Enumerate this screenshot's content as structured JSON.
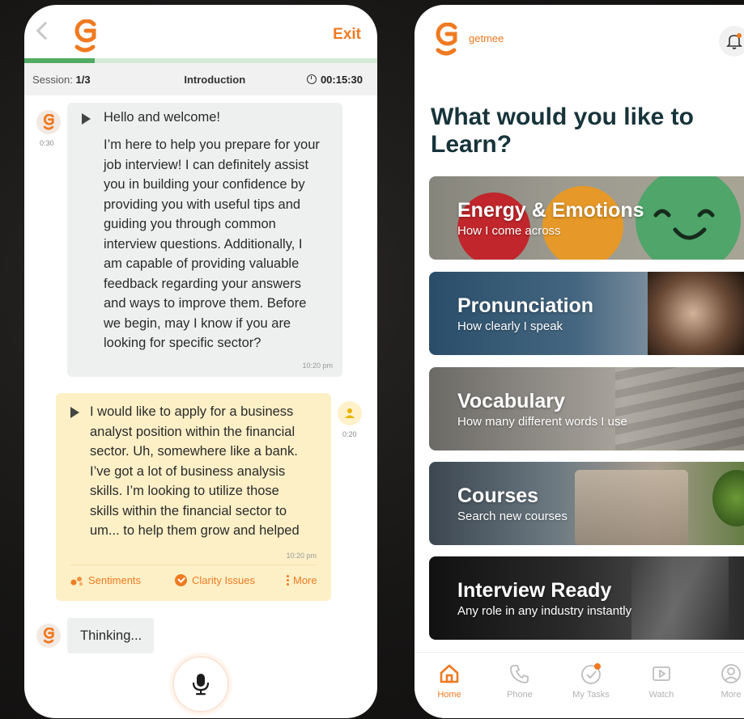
{
  "colors": {
    "brand_orange": "#ef7a21",
    "progress_green": "#52ab63",
    "heading_dark": "#17343a",
    "user_bubble": "#fdf0c7",
    "bot_bubble": "#eef0ef"
  },
  "interview": {
    "exit_label": "Exit",
    "progress_fraction": 0.2,
    "session_prefix": "Session:",
    "session_value": "1/3",
    "section_title": "Introduction",
    "timer": "00:15:30",
    "bot_message": {
      "avatar_time": "0:30",
      "greeting": "Hello and welcome!",
      "body_lines": [
        "I’m here to help you prepare for your",
        "job interview! I can definitely assist",
        "you in building your confidence by",
        "providing you with useful tips and",
        "guiding you through common",
        "interview questions. Additionally, I",
        "am capable of providing valuable",
        "feedback regarding your answers",
        "and ways to improve them. Before",
        "we begin, may I know if you are",
        "looking for specific sector?"
      ],
      "time": "10:20 pm"
    },
    "user_message": {
      "avatar_time": "0:20",
      "lines": [
        "I would like to apply for a business",
        "analyst position within the financial",
        "sector. Uh, somewhere like a bank.",
        "I’ve got a lot of business analysis",
        "skills. I’m looking to utilize those",
        "skills within the financial sector to",
        "um... to help them grow and helped"
      ],
      "time": "10:20 pm",
      "actions": {
        "sentiments": "Sentiments",
        "clarity": "Clarity Issues",
        "more": "More"
      }
    },
    "thinking_label": "Thinking..."
  },
  "learn": {
    "brand": "getmee",
    "headline_line1": "What would you like to",
    "headline_line2": "Learn?",
    "cards": [
      {
        "title": "Energy & Emotions",
        "subtitle": "How I come across"
      },
      {
        "title": "Pronunciation",
        "subtitle": "How clearly I speak"
      },
      {
        "title": "Vocabulary",
        "subtitle": "How many different words I use"
      },
      {
        "title": "Courses",
        "subtitle": "Search new courses"
      },
      {
        "title": "Interview Ready",
        "subtitle": "Any role in any industry instantly"
      }
    ],
    "nav": {
      "home": "Home",
      "phone": "Phone",
      "tasks": "My Tasks",
      "watch": "Watch",
      "more": "More"
    }
  }
}
